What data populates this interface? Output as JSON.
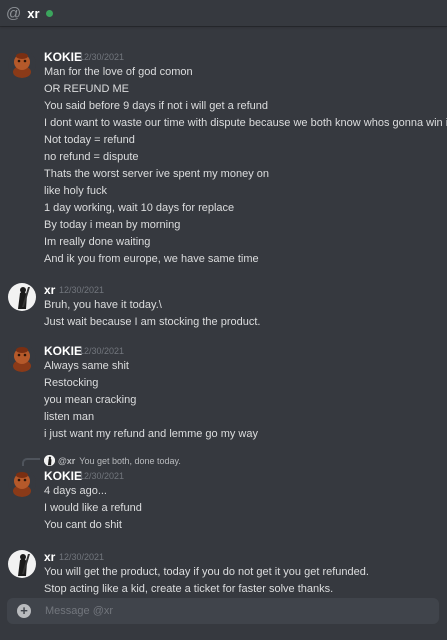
{
  "header": {
    "icon": "at-icon",
    "title": "xr",
    "status_color": "#3ba55d"
  },
  "messages": [
    {
      "username": "KOKIE",
      "timestamp": "12/30/2021",
      "lines": [
        "Man for the love of god comon",
        "OR REFUND ME",
        "You said before 9 days if not i will get a refund",
        "I dont want to waste our time with dispute because we both know whos gonna win it",
        "Not today = refund",
        "no refund = dispute",
        "Thats the worst server ive spent my money on",
        "like holy fuck",
        "1 day working, wait 10 days for replace",
        "By today i mean by morning",
        "Im really done waiting",
        "And ik you from europe, we have same time"
      ]
    },
    {
      "username": "xr",
      "timestamp": "12/30/2021",
      "lines": [
        "Bruh, you have it today.\\",
        "Just wait because I am stocking the product."
      ]
    },
    {
      "username": "KOKIE",
      "timestamp": "12/30/2021",
      "lines": [
        "Always same shit",
        "Restocking",
        "you mean cracking",
        "listen man",
        "i just want my refund and lemme go my way"
      ]
    },
    {
      "reply": {
        "name": "@xr",
        "text": "You get both, done today."
      },
      "username": "KOKIE",
      "timestamp": "12/30/2021",
      "lines": [
        "4 days ago...",
        "I would like a refund",
        "You cant do shit"
      ]
    },
    {
      "username": "xr",
      "timestamp": "12/30/2021",
      "lines": [
        "You will get the product, today if you do not get it you get refunded.",
        "Stop acting like a kid, create a ticket for faster solve thanks."
      ]
    }
  ],
  "composer": {
    "icon": "plus-circle-icon",
    "placeholder": "Message @xr"
  }
}
